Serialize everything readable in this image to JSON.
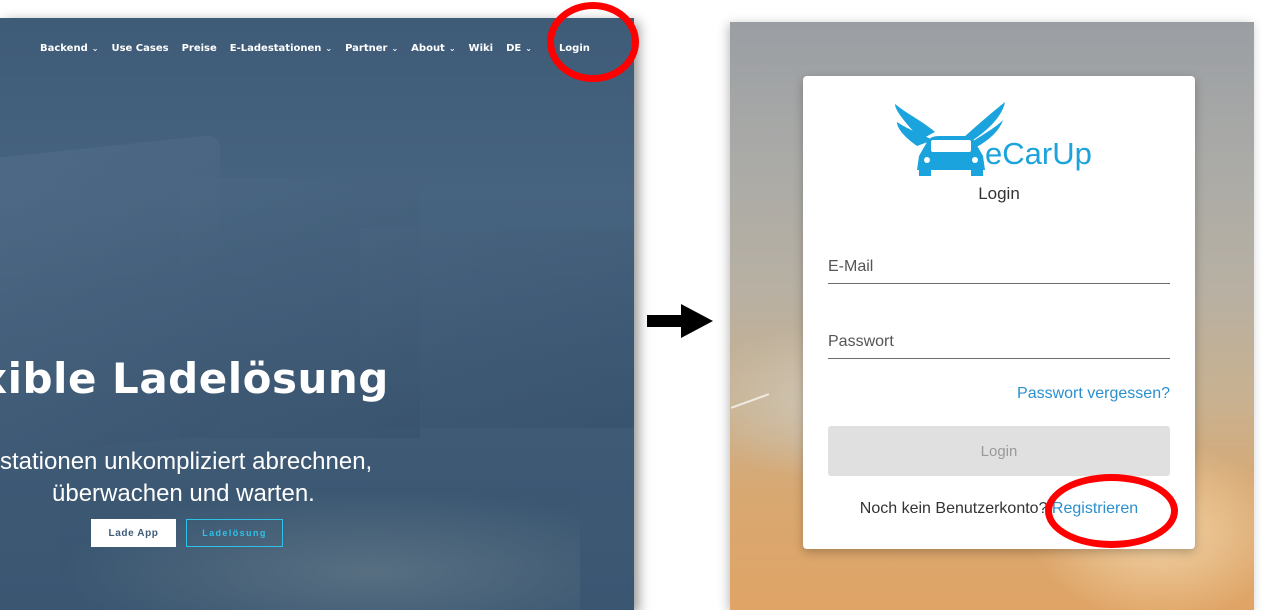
{
  "website": {
    "nav": [
      {
        "label": "Backend",
        "dropdown": true
      },
      {
        "label": "Use Cases",
        "dropdown": false
      },
      {
        "label": "Preise",
        "dropdown": false
      },
      {
        "label": "E-Ladestationen",
        "dropdown": true
      },
      {
        "label": "Partner",
        "dropdown": true
      },
      {
        "label": "About",
        "dropdown": true
      },
      {
        "label": "Wiki",
        "dropdown": false
      },
      {
        "label": "DE",
        "dropdown": true
      },
      {
        "label": "Login",
        "dropdown": false
      }
    ],
    "hero": {
      "title": "xible Ladelösung",
      "subtitle_line1": "stationen unkompliziert abrechnen,",
      "subtitle_line2": "überwachen und warten.",
      "button_primary": "Lade App",
      "button_secondary": "Ladelösung"
    }
  },
  "login": {
    "brand": "eCarUp",
    "title": "Login",
    "email_placeholder": "E-Mail",
    "password_placeholder": "Passwort",
    "forgot_link": "Passwort vergessen?",
    "login_button": "Login",
    "no_account_text": "Noch kein Benutzerkonto?",
    "register_link": "Registrieren"
  },
  "colors": {
    "highlight": "#ff0000",
    "link": "#2b8fcd",
    "brand": "#1aa3dc",
    "outline_button": "#2ec2e8"
  }
}
